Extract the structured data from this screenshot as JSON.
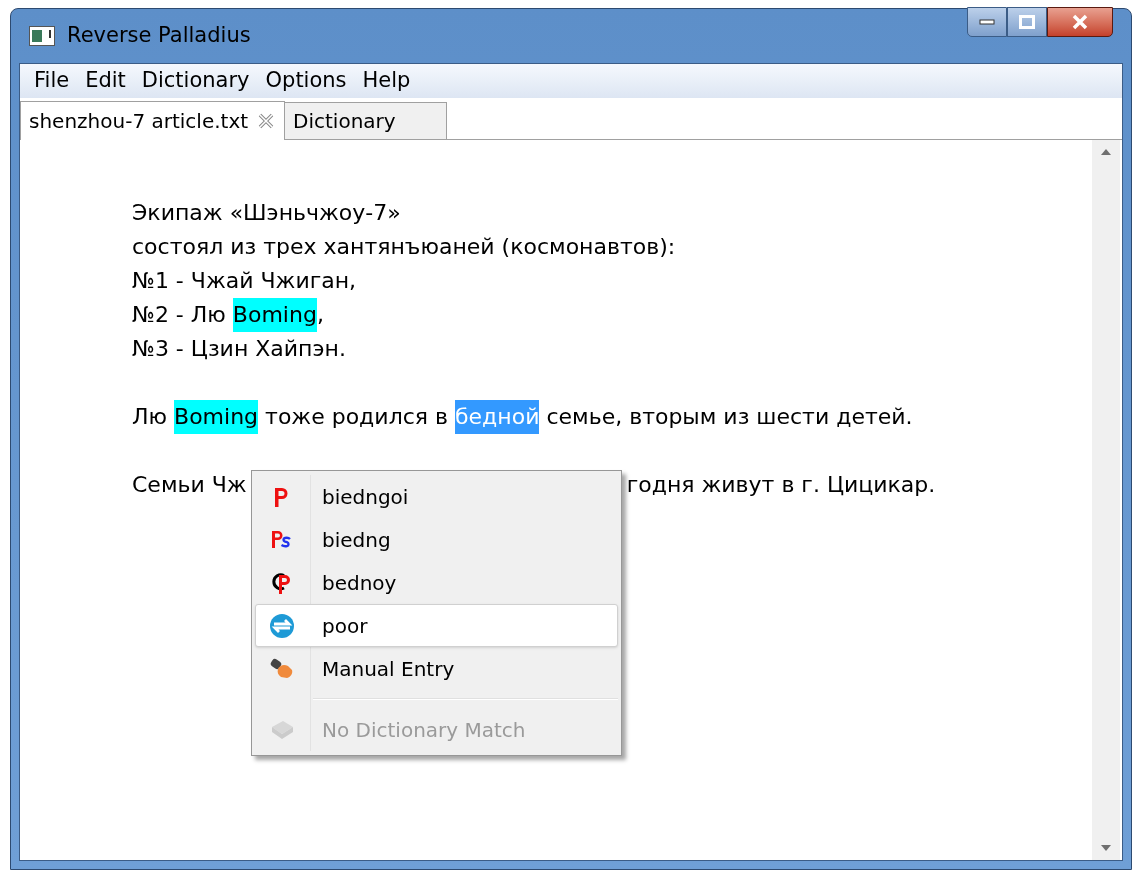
{
  "window": {
    "title": "Reverse Palladius"
  },
  "menu_bar": [
    "File",
    "Edit",
    "Dictionary",
    "Options",
    "Help"
  ],
  "tabs": [
    {
      "label": "shenzhou-7 article.txt",
      "selected": true
    },
    {
      "label": "Dictionary",
      "selected": false
    }
  ],
  "document": {
    "paragraphs": [
      {
        "lines": [
          [
            {
              "kind": "text",
              "text": "Экипаж «Шэньчжоу-7»"
            }
          ],
          [
            {
              "kind": "text",
              "text": "состоял из трех хантянъюаней (космонавтов):"
            }
          ],
          [
            {
              "kind": "text",
              "text": "№1 - Чжай Чжиган,"
            }
          ],
          [
            {
              "kind": "text",
              "text": "№2 - Лю "
            },
            {
              "kind": "highlight",
              "text": "Boming"
            },
            {
              "kind": "text",
              "text": ","
            }
          ],
          [
            {
              "kind": "text",
              "text": "№3 - Цзин Хайпэн."
            }
          ]
        ]
      },
      {
        "lines": [
          [
            {
              "kind": "text",
              "text": "Лю "
            },
            {
              "kind": "highlight",
              "text": "Boming"
            },
            {
              "kind": "text",
              "text": " тоже родился в "
            },
            {
              "kind": "selection",
              "text": "бедной"
            },
            {
              "kind": "text",
              "text": " семье, вторым из шести детей."
            }
          ]
        ]
      },
      {
        "lines": [
          [
            {
              "kind": "text",
              "text": "Семьи Чж"
            },
            {
              "kind": "gap"
            },
            {
              "kind": "text",
              "text": "годня живут в г. Цицикар."
            }
          ]
        ]
      }
    ]
  },
  "context_menu": {
    "items": [
      {
        "kind": "item",
        "label": "biedngoi",
        "selected": false,
        "disabled": false
      },
      {
        "kind": "item",
        "label": "biedng",
        "selected": false,
        "disabled": false
      },
      {
        "kind": "item",
        "label": "bednoy",
        "selected": false,
        "disabled": false
      },
      {
        "kind": "item",
        "label": "poor",
        "selected": true,
        "disabled": false
      },
      {
        "kind": "item",
        "label": "Manual Entry",
        "selected": false,
        "disabled": false
      },
      {
        "kind": "separator"
      },
      {
        "kind": "item",
        "label": "No Dictionary Match",
        "selected": false,
        "disabled": true
      }
    ]
  }
}
